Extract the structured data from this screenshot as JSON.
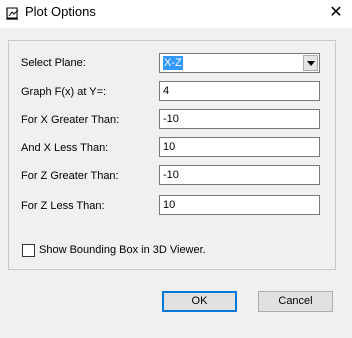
{
  "window": {
    "title": "Plot Options",
    "close_glyph": "✕"
  },
  "fields": {
    "select_plane_label": "Select Plane:",
    "select_plane_value": "X-Z",
    "graph_at_y_label": "Graph F(x) at Y=:",
    "graph_at_y_value": "4",
    "x_greater_label": "For X Greater Than:",
    "x_greater_value": "-10",
    "x_less_label": "And X Less Than:",
    "x_less_value": "10",
    "z_greater_label": "For Z Greater Than:",
    "z_greater_value": "-10",
    "z_less_label": "For Z Less Than:",
    "z_less_value": "10"
  },
  "checkbox": {
    "label": "Show Bounding Box in 3D Viewer.",
    "checked": false
  },
  "buttons": {
    "ok": "OK",
    "cancel": "Cancel"
  },
  "icons": {
    "title": "plot-window-icon",
    "dropdown": "chevron-down-icon",
    "close": "close-icon"
  }
}
